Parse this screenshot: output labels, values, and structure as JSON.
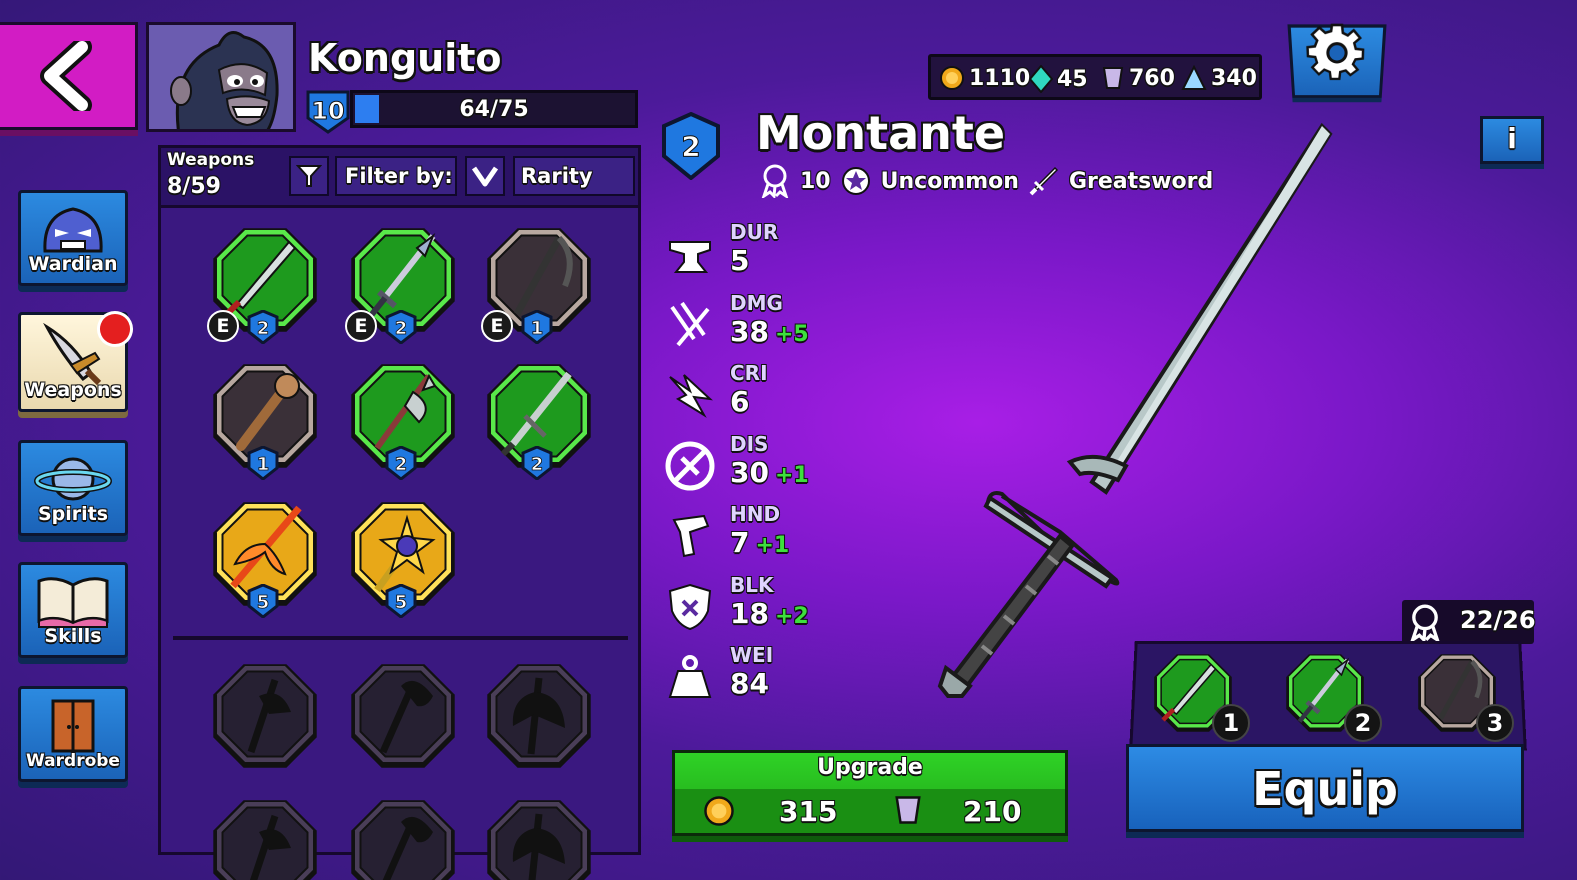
{
  "player": {
    "name": "Konguito",
    "level": "10",
    "xp_text": "64/75",
    "xp_progress": 0.0853
  },
  "nav": {
    "items": [
      {
        "label": "Wardian",
        "icon": "wardian-icon",
        "active": false
      },
      {
        "label": "Weapons",
        "icon": "weapons-icon",
        "active": true
      },
      {
        "label": "Spirits",
        "icon": "spirits-icon",
        "active": false
      },
      {
        "label": "Skills",
        "icon": "skills-icon",
        "active": false
      },
      {
        "label": "Wardrobe",
        "icon": "wardrobe-icon",
        "active": false
      }
    ]
  },
  "inventory": {
    "count_label": "Weapons",
    "count_value": "8/59",
    "filter_label": "Filter by:",
    "filter_value": "Rarity",
    "slots": [
      {
        "rarity": "uncommon",
        "level": "2",
        "equipped": "E",
        "icon": "katana-icon"
      },
      {
        "rarity": "uncommon",
        "level": "2",
        "equipped": "E",
        "icon": "spear-icon"
      },
      {
        "rarity": "common",
        "level": "1",
        "equipped": "E",
        "icon": "scythe-icon"
      },
      {
        "rarity": "common",
        "level": "1",
        "equipped": "",
        "icon": "club-icon"
      },
      {
        "rarity": "uncommon",
        "level": "2",
        "equipped": "",
        "icon": "halberd-icon"
      },
      {
        "rarity": "uncommon",
        "level": "2",
        "equipped": "",
        "icon": "greatsword-icon"
      },
      {
        "rarity": "legendary",
        "level": "5",
        "equipped": "",
        "icon": "fire-spear-icon"
      },
      {
        "rarity": "legendary",
        "level": "5",
        "equipped": "",
        "icon": "star-mace-icon"
      }
    ]
  },
  "currency": {
    "gold": "1110",
    "gems": "45",
    "crystals": "760",
    "shards": "340",
    "colors": {
      "gold": "#f0a81a",
      "gems": "#2fd8c0",
      "crystals": "#c9b8e8",
      "shards": "#9ad8ff"
    }
  },
  "weapon": {
    "name": "Montante",
    "level": "2",
    "mastery": "10",
    "rarity": "Uncommon",
    "type": "Greatsword",
    "stats": [
      {
        "label": "DUR",
        "value": "5",
        "bonus": "",
        "icon": "anvil-icon"
      },
      {
        "label": "DMG",
        "value": "38",
        "bonus": "+5",
        "icon": "slash-icon"
      },
      {
        "label": "CRI",
        "value": "6",
        "bonus": "",
        "icon": "critical-icon"
      },
      {
        "label": "DIS",
        "value": "30",
        "bonus": "+1",
        "icon": "disarm-icon"
      },
      {
        "label": "HND",
        "value": "7",
        "bonus": "+1",
        "icon": "handling-icon"
      },
      {
        "label": "BLK",
        "value": "18",
        "bonus": "+2",
        "icon": "shield-icon"
      },
      {
        "label": "WEI",
        "value": "84",
        "bonus": "",
        "icon": "weight-icon"
      }
    ]
  },
  "upgrade": {
    "label": "Upgrade",
    "gold_cost": "315",
    "crystal_cost": "210"
  },
  "loadout": {
    "count": "22/26",
    "slots": [
      {
        "number": "1",
        "rarity": "uncommon",
        "icon": "katana-icon"
      },
      {
        "number": "2",
        "rarity": "uncommon",
        "icon": "spear-icon"
      },
      {
        "number": "3",
        "rarity": "common",
        "icon": "scythe-icon"
      }
    ]
  },
  "equip_label": "Equip"
}
